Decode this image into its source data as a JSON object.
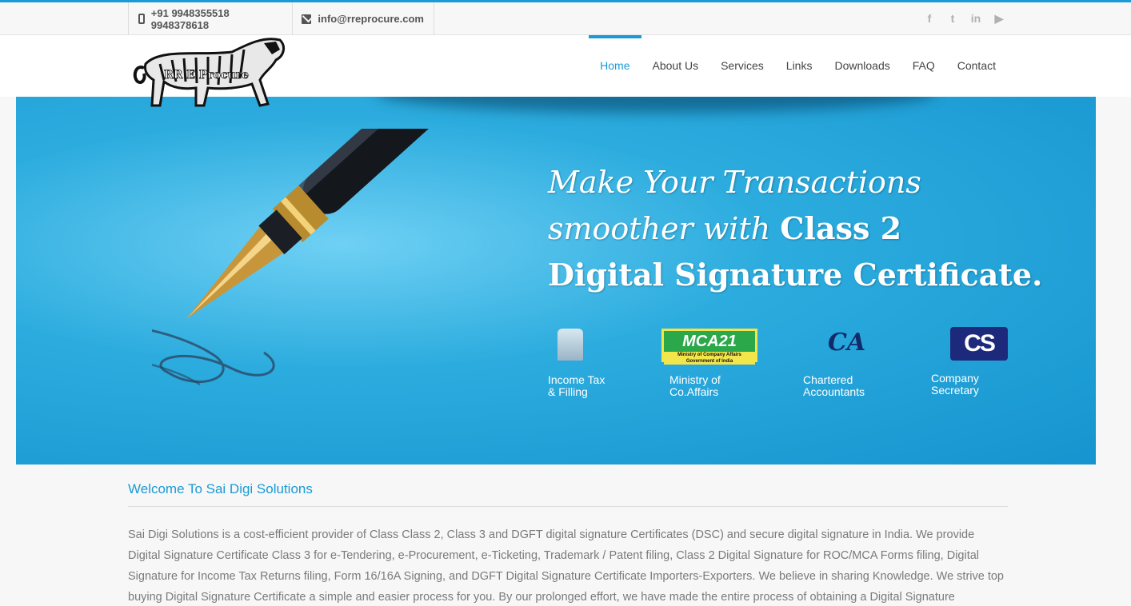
{
  "topbar": {
    "phone": "+91 9948355518  9948378618",
    "email": "info@rreprocure.com",
    "social": [
      "facebook-icon",
      "twitter-icon",
      "linkedin-icon",
      "youtube-icon"
    ]
  },
  "logo": {
    "text": "RR E Procure"
  },
  "nav": {
    "items": [
      "Home",
      "About Us",
      "Services",
      "Links",
      "Downloads",
      "FAQ",
      "Contact"
    ],
    "active": "Home"
  },
  "banner": {
    "line1": "Make Your Transactions",
    "line2a": "smoother with ",
    "line2b": "Class 2",
    "line3": "Digital  Signature Certificate.",
    "logos": [
      {
        "caption1": "Income Tax",
        "caption2": "& Filling"
      },
      {
        "caption1": "Ministry of",
        "caption2": "Co.Affairs",
        "mark": "MCA21",
        "mark_small": "Ministry of Company Affairs Government of India"
      },
      {
        "caption1": "Chartered",
        "caption2": "Accountants",
        "mark": "CA"
      },
      {
        "caption1": "Company",
        "caption2": "Secretary",
        "mark": "CS"
      }
    ],
    "colors": {
      "accent": "#1a9ad6",
      "banner": "#1a9ad6"
    }
  },
  "main": {
    "heading": "Welcome To Sai Digi Solutions",
    "paragraph": "Sai Digi Solutions is a cost-efficient provider of Class Class 2, Class 3 and DGFT digital signature Certificates (DSC) and secure digital signature in India. We provide Digital Signature Certificate Class 3 for e-Tendering, e-Procurement, e-Ticketing, Trademark / Patent filing, Class 2 Digital Signature for ROC/MCA Forms filing, Digital Signature for Income Tax Returns filing, Form 16/16A Signing, and DGFT Digital Signature Certificate Importers-Exporters. We believe in sharing Knowledge. We strive top buying Digital Signature Certificate a simple and easier process for you. By our prolonged effort, we have made the entire process of obtaining a Digital Signature"
  }
}
